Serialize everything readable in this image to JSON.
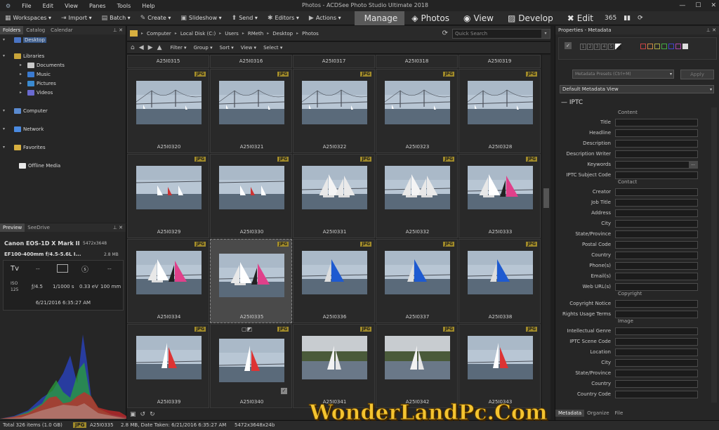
{
  "app": {
    "title": "Photos - ACDSee Photo Studio Ultimate 2018",
    "menu": [
      "File",
      "Edit",
      "View",
      "Panes",
      "Tools",
      "Help"
    ]
  },
  "toolbar": {
    "items": [
      {
        "icon": "workspaces-icon",
        "glyph": "▦",
        "label": "Workspaces ▾"
      },
      {
        "icon": "import-icon",
        "glyph": "⇥",
        "label": "Import ▾"
      },
      {
        "icon": "batch-icon",
        "glyph": "▤",
        "label": "Batch ▾"
      },
      {
        "icon": "create-icon",
        "glyph": "✎",
        "label": "Create ▾"
      },
      {
        "icon": "slideshow-icon",
        "glyph": "▣",
        "label": "Slideshow ▾"
      },
      {
        "icon": "send-icon",
        "glyph": "⬆",
        "label": "Send ▾"
      },
      {
        "icon": "editors-icon",
        "glyph": "✱",
        "label": "Editors ▾"
      },
      {
        "icon": "actions-icon",
        "glyph": "▶",
        "label": "Actions ▾"
      }
    ],
    "modes": [
      {
        "label": "Manage",
        "icon": "manage-icon",
        "active": true
      },
      {
        "label": "Photos",
        "icon": "photos-icon",
        "active": false
      },
      {
        "label": "View",
        "icon": "view-eye-icon",
        "active": false
      },
      {
        "label": "Develop",
        "icon": "develop-icon",
        "active": false
      },
      {
        "label": "Edit",
        "icon": "edit-tools-icon",
        "active": false
      }
    ],
    "mode_glyphs": {
      "Manage": "",
      "Photos": "◈",
      "View": "◉",
      "Develop": "▨",
      "Edit": "✖"
    },
    "extra_icons": [
      {
        "name": "360-icon",
        "glyph": "365"
      },
      {
        "name": "dashboard-icon",
        "glyph": "▮▮"
      },
      {
        "name": "sync-icon",
        "glyph": "⟳"
      }
    ]
  },
  "left_panel": {
    "tabs": [
      "Folders",
      "Catalog",
      "Calendar"
    ],
    "tree": [
      {
        "label": "Desktop",
        "level": 0,
        "selected": true,
        "color": "#4a74c4"
      },
      {
        "label": "Libraries",
        "level": 0,
        "color": "#c9a53a"
      },
      {
        "label": "Documents",
        "level": 1,
        "color": "#c9c9c9"
      },
      {
        "label": "Music",
        "level": 1,
        "color": "#3a7ad0"
      },
      {
        "label": "Pictures",
        "level": 1,
        "color": "#3a8ad0"
      },
      {
        "label": "Videos",
        "level": 1,
        "color": "#6a6ad0"
      },
      {
        "label": "Computer",
        "level": 0,
        "color": "#5a8ad0"
      },
      {
        "label": "Network",
        "level": 0,
        "color": "#4a8ae0"
      },
      {
        "label": "Favorites",
        "level": 0,
        "color": "#d8b040"
      },
      {
        "label": "Offline Media",
        "level": 0,
        "color": "#e8e8e8"
      }
    ]
  },
  "preview_panel": {
    "tabs": [
      "Preview",
      "SeeDrive"
    ],
    "camera": "Canon EOS-1D X Mark II",
    "resolution": "5472x3648",
    "lens": "EF100-400mm f/4.5-5.6L I...",
    "size": "2.8 MB",
    "mode": "Tv",
    "dashes": "--",
    "iso": "ISO\n125",
    "aperture": "ƒ/4.5",
    "shutter": "1/1000 s",
    "ev": "0.33 eV",
    "focal": "100 mm",
    "date": "6/21/2016 6:35:27 AM"
  },
  "path_bar": {
    "crumbs": [
      "Computer",
      "Local Disk (C:)",
      "Users",
      "RMeth",
      "Desktop",
      "Photos"
    ],
    "search_placeholder": "Quick Search"
  },
  "filter_bar": [
    "Filter ▾",
    "Group ▾",
    "Sort ▾",
    "View ▾",
    "Select ▾"
  ],
  "thumbnails": {
    "top_row": [
      "A25I0315",
      "A25I0316",
      "A25I0317",
      "A25I0318",
      "A25I0319"
    ],
    "items": [
      {
        "name": "A25I0320",
        "badge": "JPG",
        "scene": "bridge"
      },
      {
        "name": "A25I0321",
        "badge": "JPG",
        "scene": "bridge"
      },
      {
        "name": "A25I0322",
        "badge": "JPG",
        "scene": "bridge"
      },
      {
        "name": "A25I0323",
        "badge": "JPG",
        "scene": "bridge"
      },
      {
        "name": "A25I0328",
        "badge": "JPG",
        "scene": "bridge"
      },
      {
        "name": "A25I0329",
        "badge": "JPG",
        "scene": "smallsails"
      },
      {
        "name": "A25I0330",
        "badge": "JPG",
        "scene": "smallsails"
      },
      {
        "name": "A25I0331",
        "badge": "JPG",
        "scene": "whitesails"
      },
      {
        "name": "A25I0332",
        "badge": "JPG",
        "scene": "whitesails"
      },
      {
        "name": "A25I0333",
        "badge": "JPG",
        "scene": "pinksail"
      },
      {
        "name": "A25I0334",
        "badge": "JPG",
        "scene": "pinksail"
      },
      {
        "name": "A25I0335",
        "badge": "JPG",
        "scene": "pinksail",
        "selected": true
      },
      {
        "name": "A25I0336",
        "badge": "JPG",
        "scene": "bluesail"
      },
      {
        "name": "A25I0337",
        "badge": "JPG",
        "scene": "bluesail"
      },
      {
        "name": "A25I0338",
        "badge": "JPG",
        "scene": "bluesail"
      },
      {
        "name": "A25I0339",
        "badge": "JPG",
        "scene": "redsail"
      },
      {
        "name": "A25I0340",
        "badge": "JPG",
        "scene": "redsail"
      },
      {
        "name": "A25I0341",
        "badge": "JPG",
        "scene": "shore"
      },
      {
        "name": "A25I0342",
        "badge": "JPG",
        "scene": "shore"
      },
      {
        "name": "A25I0343",
        "badge": "JPG",
        "scene": "redsail"
      }
    ]
  },
  "properties": {
    "title": "Properties - Metadata",
    "ratings": [
      "1",
      "2",
      "3",
      "4",
      "5"
    ],
    "presets_placeholder": "Metadata Presets (Ctrl+M)",
    "apply": "Apply",
    "view": "Default Metadata View",
    "section": "IPTC",
    "groups": [
      {
        "header": "Content",
        "fields": [
          "Title",
          "Headline",
          "Description",
          "Description Writer",
          "Keywords",
          "IPTC Subject Code"
        ]
      },
      {
        "header": "Contact",
        "fields": [
          "Creator",
          "Job Title",
          "Address",
          "City",
          "State/Province",
          "Postal Code",
          "Country",
          "Phone(s)",
          "Email(s)",
          "Web URL(s)"
        ]
      },
      {
        "header": "Copyright",
        "fields": [
          "Copyright Notice",
          "Rights Usage Terms"
        ]
      },
      {
        "header": "Image",
        "fields": [
          "Intellectual Genre",
          "IPTC Scene Code",
          "Location",
          "City",
          "State/Province",
          "Country",
          "Country Code"
        ]
      }
    ],
    "bottom_tabs": [
      "Metadata",
      "Organize",
      "File"
    ]
  },
  "status": {
    "total": "Total 326 items  (1.0 GB)",
    "badge": "JPG",
    "file": "A25I0335",
    "info": "2.8 MB, Date Taken: 6/21/2016 6:35:27 AM",
    "dims": "5472x3648x24b"
  },
  "watermark": "WonderLandPc.Com"
}
